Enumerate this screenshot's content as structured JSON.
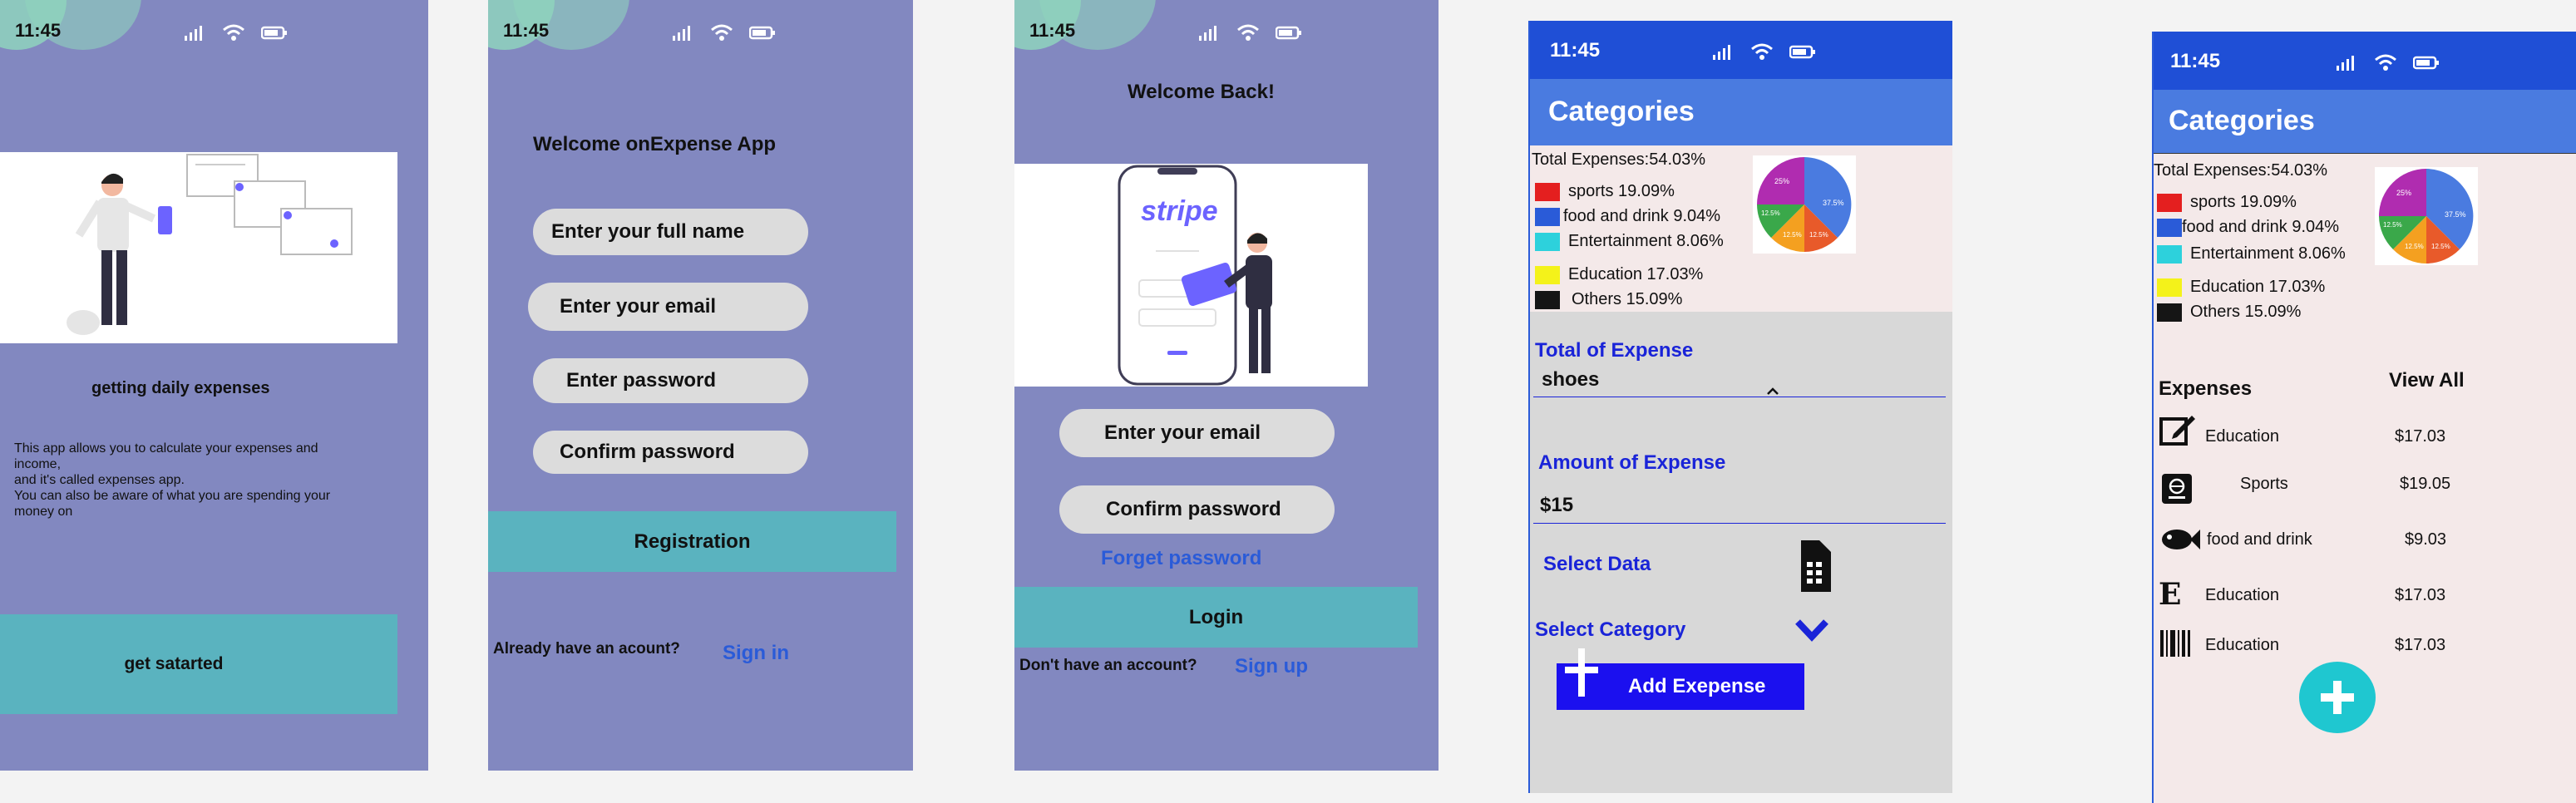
{
  "status": {
    "time": "11:45"
  },
  "screen1": {
    "heading": "getting  daily expenses",
    "desc1": "This app allows you to calculate your expenses and income,",
    "desc2": " and it's called expenses app.",
    "desc3": "You can also be aware of what you are spending your money on",
    "button": "get satarted"
  },
  "screen2": {
    "title": "Welcome onExpense App",
    "fullname": "Enter your full name",
    "email": "Enter your email",
    "password": "Enter password",
    "confirm": "Confirm password",
    "register": "Registration",
    "have_account": "Already have an acount?",
    "signin": "Sign in"
  },
  "screen3": {
    "title": "Welcome Back!",
    "stripe": "stripe",
    "email": "Enter your email",
    "confirm": "Confirm password",
    "forget": "Forget  password",
    "login": "Login",
    "no_account": "Don't have  an account?",
    "signup": "Sign up"
  },
  "categories": {
    "title": "Categories",
    "total": "Total Expenses:54.03%",
    "legend": [
      {
        "label": "sports 19.09%",
        "color": "#e41f1f"
      },
      {
        "label": "food and drink 9.04%",
        "color": "#2a5bd8"
      },
      {
        "label": "Entertainment 8.06%",
        "color": "#2dd1dc"
      },
      {
        "label": "Education 17.03%",
        "color": "#f4f21a"
      },
      {
        "label": "Others 15.09%",
        "color": "#151515"
      }
    ],
    "pie_labels": [
      "25%",
      "37.5%",
      "12.5%",
      "12.5%",
      "12.5%"
    ]
  },
  "screen4": {
    "total_label": "Total of  Expense",
    "total_value": "shoes",
    "amount_label": "Amount of Expense",
    "amount_value": "$15",
    "select_data": "Select Data",
    "select_category": "Select Category",
    "add": "Add Exepense"
  },
  "screen5": {
    "expenses": "Expenses",
    "view_all": "View All",
    "items": [
      {
        "name": "Education",
        "amount": "$17.03"
      },
      {
        "name": "Sports",
        "amount": "$19.05"
      },
      {
        "name": "food and drink",
        "amount": "$9.03"
      },
      {
        "name": "Education",
        "amount": "$17.03"
      },
      {
        "name": "Education",
        "amount": "$17.03"
      }
    ]
  },
  "colors": {
    "purple": "#8288c0",
    "teal": "#5ab3bf",
    "blue": "#1f4fd6",
    "accent": "#1a24d8",
    "fab": "#1fc7d0"
  }
}
